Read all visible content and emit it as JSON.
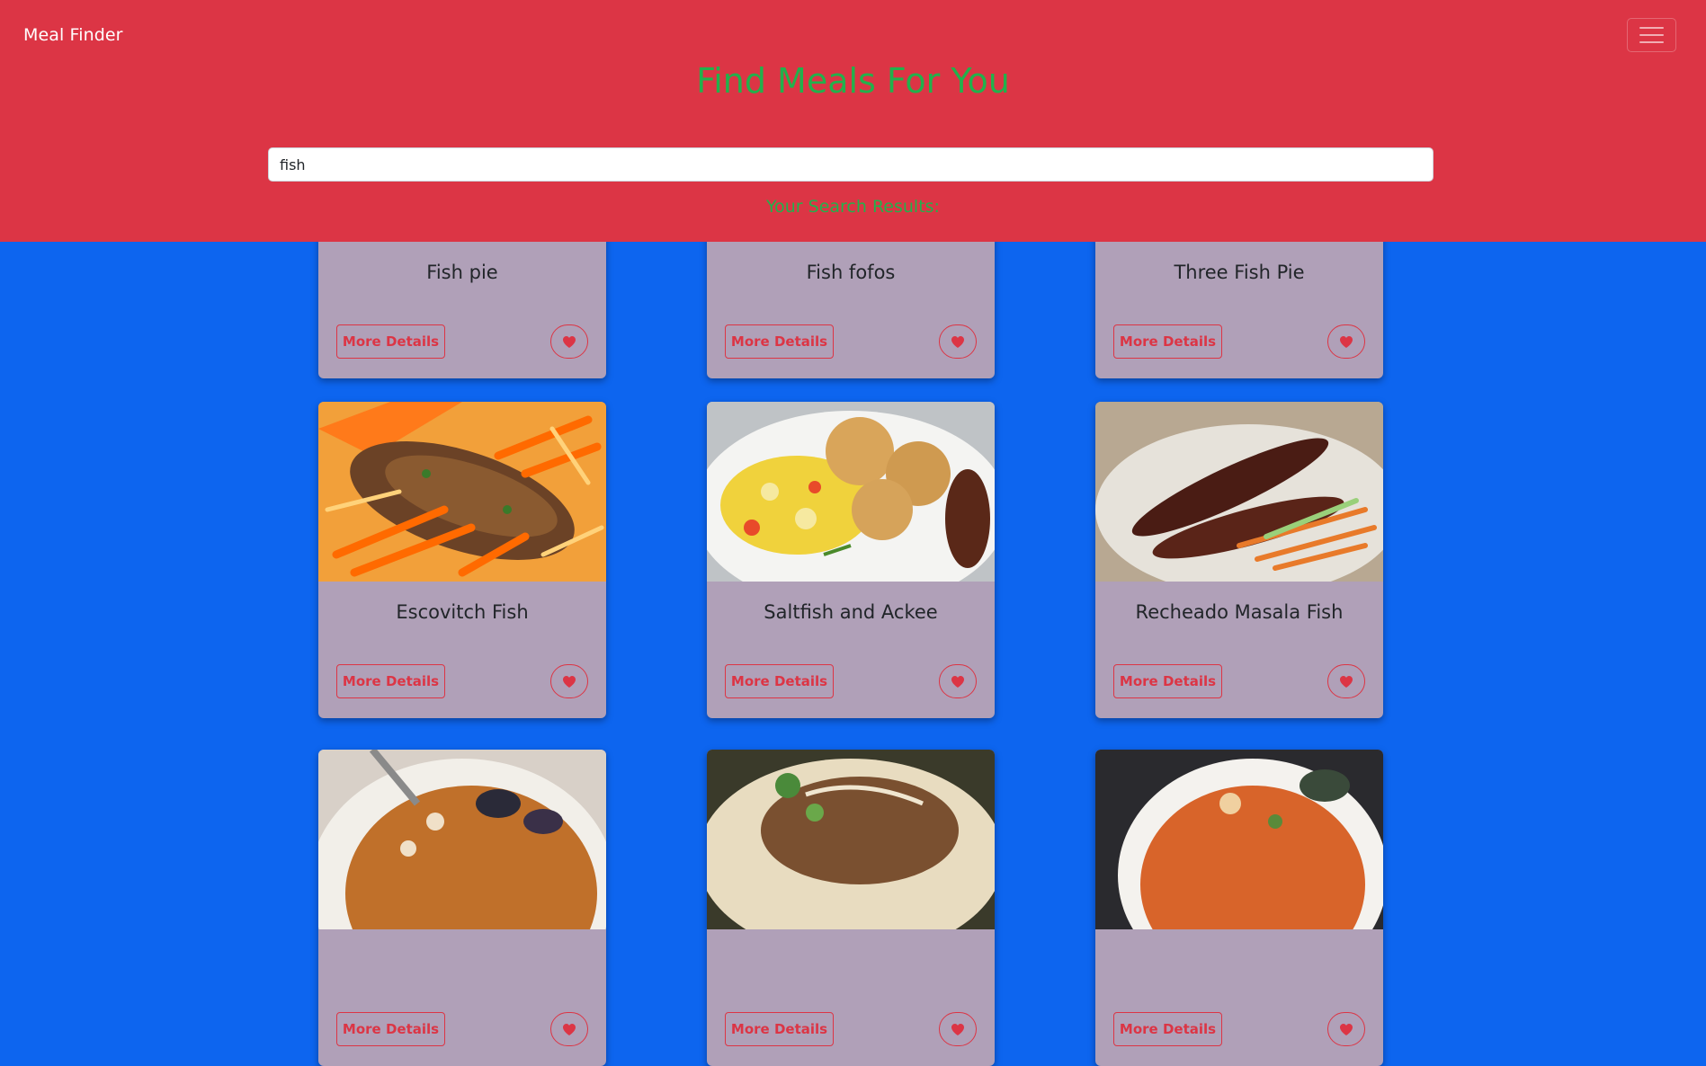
{
  "navbar": {
    "brand": "Meal Finder",
    "menu_icon": "hamburger-menu-icon"
  },
  "hero": {
    "title": "Find Meals For You",
    "results_label": "Your Search Results:"
  },
  "search": {
    "value": "fish",
    "placeholder": ""
  },
  "colors": {
    "header": "#dc3545",
    "background": "#0d65ef",
    "accent_green": "#22b14c",
    "card": "#b0a0b8"
  },
  "meals": [
    {
      "name": "Fish pie",
      "button": "More Details",
      "favorite_icon": "heart-icon"
    },
    {
      "name": "Fish fofos",
      "button": "More Details",
      "favorite_icon": "heart-icon"
    },
    {
      "name": "Three Fish Pie",
      "button": "More Details",
      "favorite_icon": "heart-icon"
    },
    {
      "name": "Escovitch Fish",
      "button": "More Details",
      "favorite_icon": "heart-icon"
    },
    {
      "name": "Saltfish and Ackee",
      "button": "More Details",
      "favorite_icon": "heart-icon"
    },
    {
      "name": "Recheado Masala Fish",
      "button": "More Details",
      "favorite_icon": "heart-icon"
    },
    {
      "name": "",
      "button": "More Details",
      "favorite_icon": "heart-icon"
    },
    {
      "name": "",
      "button": "More Details",
      "favorite_icon": "heart-icon"
    },
    {
      "name": "",
      "button": "More Details",
      "favorite_icon": "heart-icon"
    }
  ]
}
